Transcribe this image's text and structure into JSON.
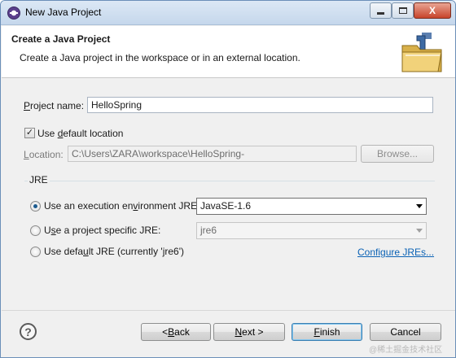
{
  "window": {
    "title": "New Java Project",
    "controls": {
      "minimize_icon": "minimize-icon",
      "maximize_icon": "maximize-icon",
      "close_label": "X"
    }
  },
  "header": {
    "title": "Create a Java Project",
    "description": "Create a Java project in the workspace or in an external location.",
    "icon": "new-java-project-wizard-icon"
  },
  "form": {
    "project_name": {
      "label_pre": "",
      "label_ul": "P",
      "label_post": "roject name:",
      "value": "HelloSpring"
    },
    "use_default_location": {
      "checked": true,
      "label_pre": "Use ",
      "label_ul": "d",
      "label_post": "efault location"
    },
    "location": {
      "label_pre": "",
      "label_ul": "L",
      "label_post": "ocation:",
      "value": "C:\\Users\\ZARA\\workspace\\HelloSpring-"
    },
    "browse_label": "Browse..."
  },
  "jre": {
    "group_label": "JRE",
    "options": [
      {
        "label_pre": "Use an execution en",
        "label_ul": "v",
        "label_post": "ironment JRE:",
        "selected": true,
        "combo_value": "JavaSE-1.6",
        "combo_enabled": true
      },
      {
        "label_pre": "U",
        "label_ul": "s",
        "label_post": "e a project specific JRE:",
        "selected": false,
        "combo_value": "jre6",
        "combo_enabled": false
      },
      {
        "label_pre": "Use defa",
        "label_ul": "u",
        "label_post": "lt JRE (currently 'jre6')",
        "selected": false
      }
    ],
    "configure_link": "Configure JREs..."
  },
  "footer": {
    "help_icon": "help-icon",
    "help_glyph": "?",
    "back": {
      "pre": "< ",
      "ul": "B",
      "post": "ack"
    },
    "next": {
      "pre": "",
      "ul": "N",
      "post": "ext >"
    },
    "finish": {
      "pre": "",
      "ul": "F",
      "post": "inish"
    },
    "cancel_label": "Cancel"
  },
  "watermark": "@稀土掘金技术社区"
}
